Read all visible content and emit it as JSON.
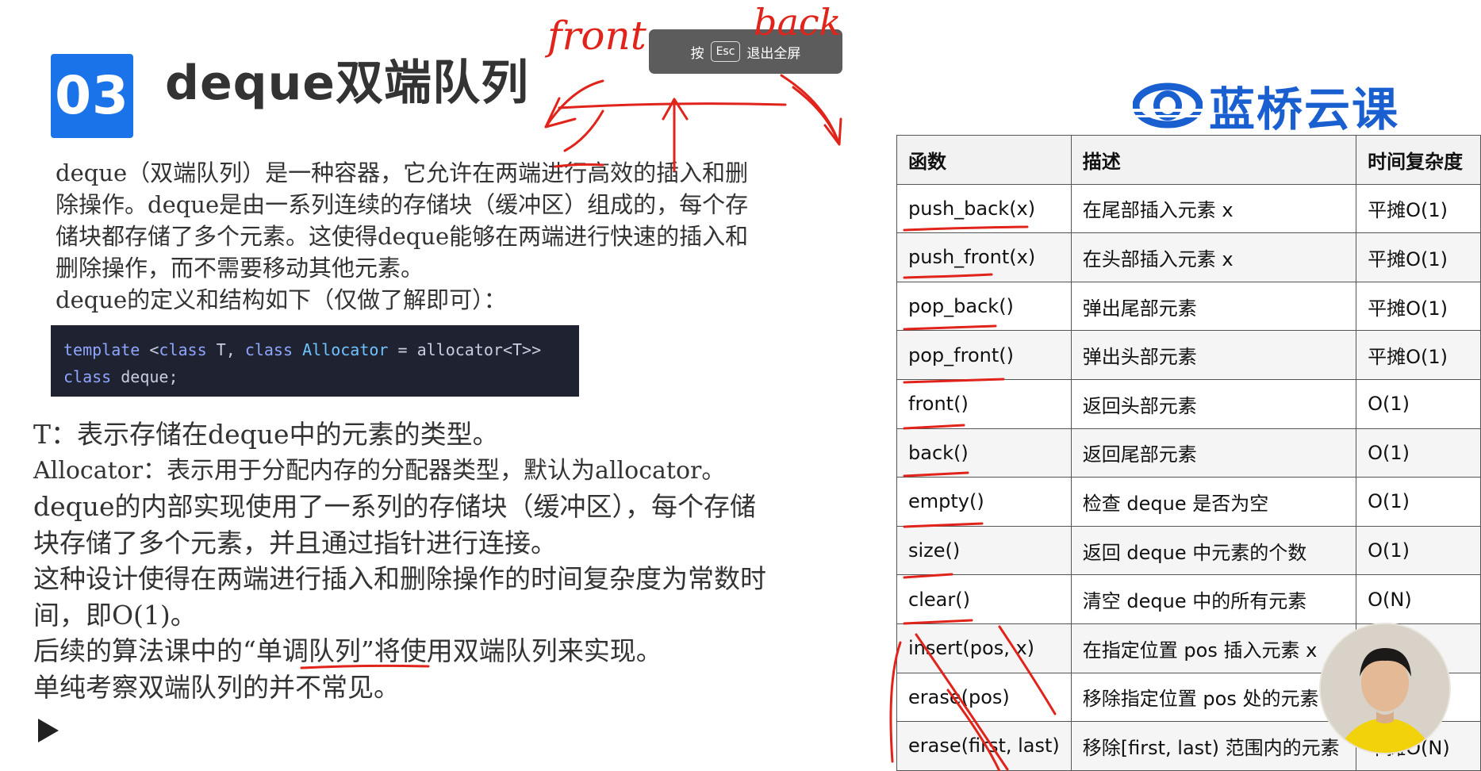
{
  "slide": {
    "number_badge": "03",
    "title": "deque双端队列"
  },
  "toast": {
    "prefix": "按",
    "key": "Esc",
    "suffix": "退出全屏"
  },
  "logo": {
    "text": "蓝桥云课",
    "icon": "lanqiao-logo-icon"
  },
  "intro": [
    "deque（双端队列）是一种容器，它允许在两端进行高效的插入和删",
    "除操作。deque是由一系列连续的存储块（缓冲区）组成的，每个存",
    "储块都存储了多个元素。这使得deque能够在两端进行快速的插入和",
    "删除操作，而不需要移动其他元素。",
    "deque的定义和结构如下（仅做了解即可）："
  ],
  "code": {
    "line1_kw1": "template",
    "line1_rest1": " <",
    "line1_kw2": "class",
    "line1_t": " T, ",
    "line1_kw3": "class",
    "line1_ty": " Allocator",
    "line1_rest2": " = allocator<T>>",
    "line2_kw": "class",
    "line2_rest": " deque;"
  },
  "details": [
    "T：表示存储在deque中的元素的类型。",
    "Allocator：表示用于分配内存的分配器类型，默认为allocator。",
    "deque的内部实现使用了一系列的存储块（缓冲区），每个存储",
    "块存储了多个元素，并且通过指针进行连接。",
    "这种设计使得在两端进行插入和删除操作的时间复杂度为常数时",
    "间，即O(1)。",
    "后续的算法课中的“单调队列”将使用双端队列来实现。",
    "单纯考察双端队列的并不常见。"
  ],
  "table": {
    "headers": [
      "函数",
      "描述",
      "时间复杂度"
    ],
    "rows": [
      [
        "push_back(x)",
        "在尾部插入元素 x",
        "平摊O(1)"
      ],
      [
        "push_front(x)",
        "在头部插入元素 x",
        "平摊O(1)"
      ],
      [
        "pop_back()",
        "弹出尾部元素",
        "平摊O(1)"
      ],
      [
        "pop_front()",
        "弹出头部元素",
        "平摊O(1)"
      ],
      [
        "front()",
        "返回头部元素",
        "O(1)"
      ],
      [
        "back()",
        "返回尾部元素",
        "O(1)"
      ],
      [
        "empty()",
        "检查 deque 是否为空",
        "O(1)"
      ],
      [
        "size()",
        "返回 deque 中元素的个数",
        "O(1)"
      ],
      [
        "clear()",
        "清空 deque 中的所有元素",
        "O(N)"
      ],
      [
        "insert(pos, x)",
        "在指定位置 pos 插入元素 x",
        ""
      ],
      [
        "erase(pos)",
        "移除指定位置 pos 处的元素",
        ""
      ],
      [
        "erase(first, last)",
        "移除[first, last) 范围内的元素",
        "平摊O(N)"
      ]
    ]
  },
  "annotations": {
    "front_label": "front",
    "back_label": "back",
    "ink_color": "#e0241b"
  },
  "colors": {
    "badge": "#1a73e8",
    "logo": "#1a5fd0",
    "code_bg": "#1f2230"
  }
}
